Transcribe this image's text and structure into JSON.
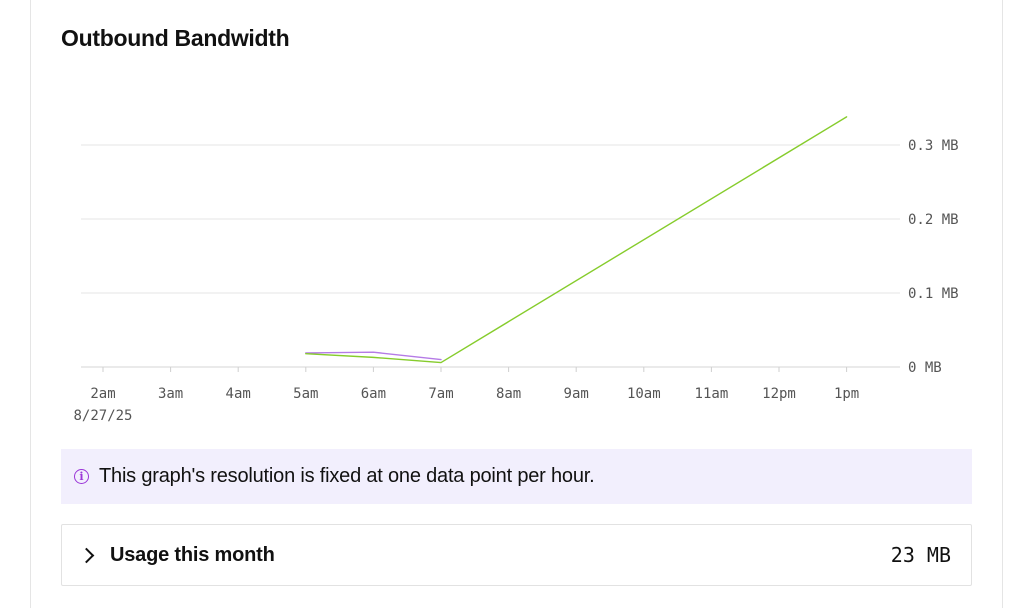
{
  "header": {
    "title": "Outbound Bandwidth"
  },
  "chart_data": {
    "type": "line",
    "title": "Outbound Bandwidth",
    "x_labels": [
      "2am",
      "3am",
      "4am",
      "5am",
      "6am",
      "7am",
      "8am",
      "9am",
      "10am",
      "11am",
      "12pm",
      "1pm"
    ],
    "x_date_label": "8/27/25",
    "y_ticks": [
      {
        "value": 0,
        "label": "0 MB"
      },
      {
        "value": 0.1,
        "label": "0.1 MB"
      },
      {
        "value": 0.2,
        "label": "0.2 MB"
      },
      {
        "value": 0.3,
        "label": "0.3 MB"
      }
    ],
    "ylim": [
      0,
      0.3
    ],
    "grid": true,
    "y_axis_side": "right",
    "series": [
      {
        "color": "#b57be6",
        "points": [
          {
            "x": "5am",
            "y": 0.019
          },
          {
            "x": "6am",
            "y": 0.02
          },
          {
            "x": "7am",
            "y": 0.01
          }
        ]
      },
      {
        "color": "#86cc2c",
        "points": [
          {
            "x": "5am",
            "y": 0.018
          },
          {
            "x": "6am",
            "y": 0.013
          },
          {
            "x": "7am",
            "y": 0.006
          },
          {
            "x": "1pm",
            "y": 0.338
          }
        ]
      }
    ]
  },
  "notice": {
    "icon": "info-icon",
    "text": "This graph's resolution is fixed at one data point per hour."
  },
  "usage": {
    "label": "Usage this month",
    "value": "23 MB"
  }
}
